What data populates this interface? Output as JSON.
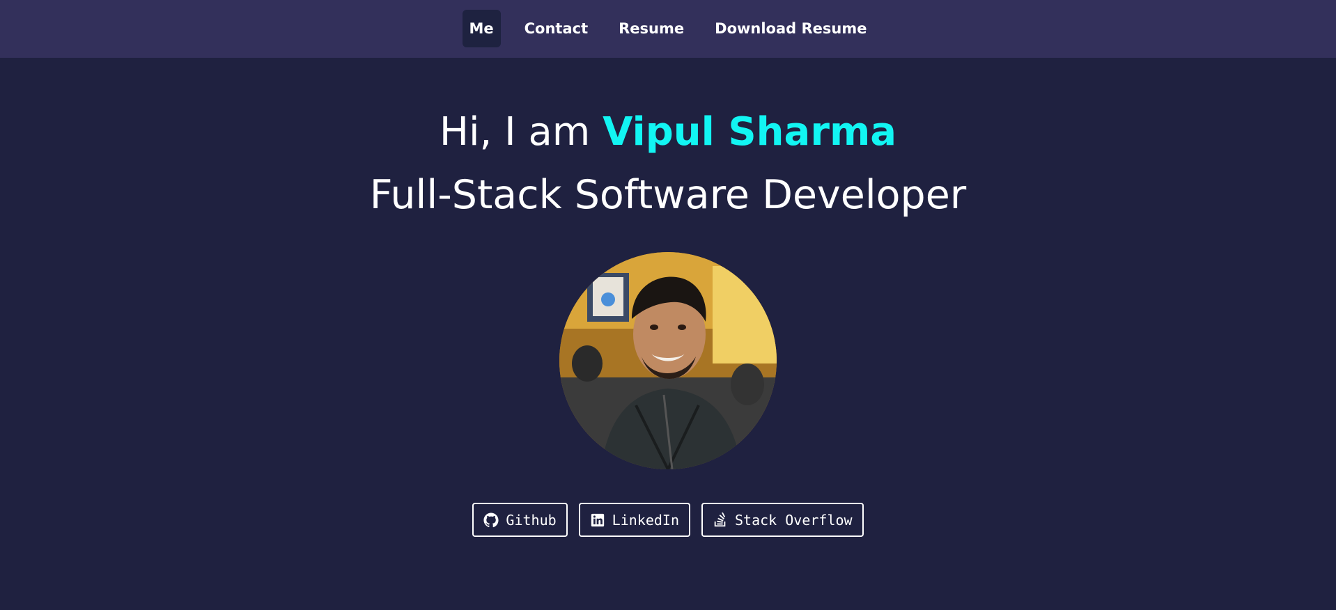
{
  "nav": {
    "items": [
      {
        "label": "Me",
        "active": true
      },
      {
        "label": "Contact"
      },
      {
        "label": "Resume"
      },
      {
        "label": "Download Resume"
      }
    ]
  },
  "hero": {
    "greeting_prefix": "Hi, I am ",
    "name": "Vipul Sharma",
    "title": "Full-Stack Software Developer"
  },
  "social": {
    "github": {
      "label": "Github",
      "icon": "github-icon"
    },
    "linkedin": {
      "label": "LinkedIn",
      "icon": "linkedin-icon"
    },
    "stackoverflow": {
      "label": "Stack Overflow",
      "icon": "stack-overflow-icon"
    }
  },
  "colors": {
    "background": "#1f2140",
    "navbar": "#33305b",
    "accent": "#12f5f3"
  }
}
